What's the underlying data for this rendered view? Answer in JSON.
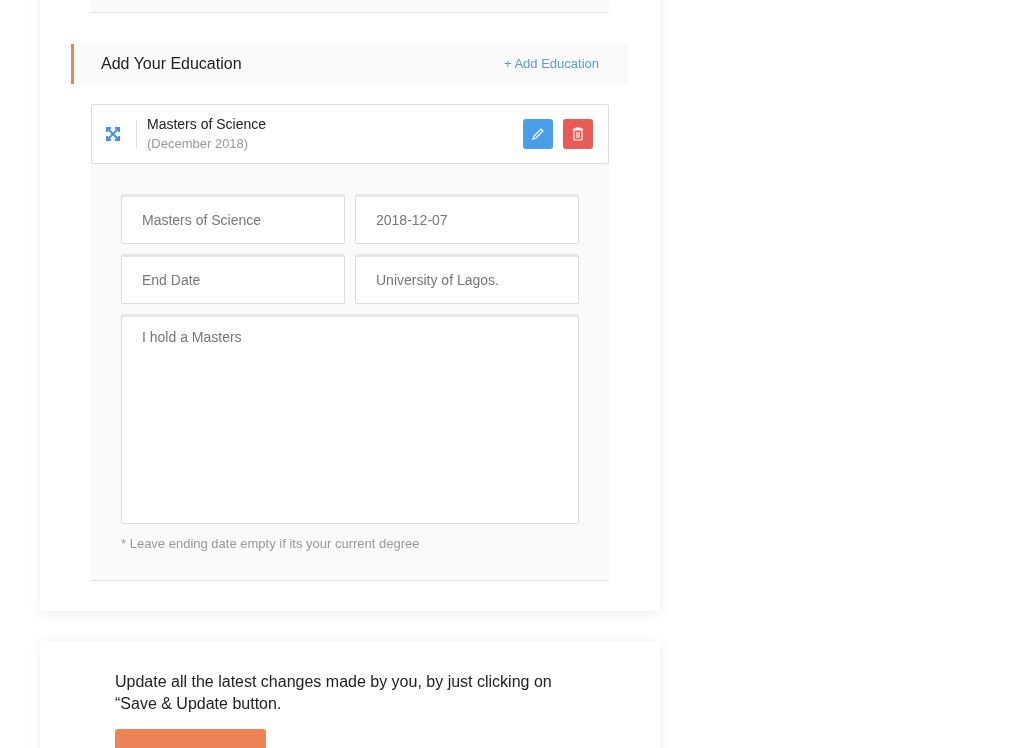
{
  "section": {
    "title": "Add Your Education",
    "add_link": "+ Add Education"
  },
  "education_items": [
    {
      "title": "Masters of Science",
      "date": "(December 2018)",
      "expanded": true,
      "fields": [
        {
          "kind": "input",
          "value": "Masters of Science"
        },
        {
          "kind": "input",
          "value": "2018-12-07"
        },
        {
          "kind": "input",
          "placeholder": "End Date"
        },
        {
          "kind": "input",
          "value": "University of Lagos."
        },
        {
          "kind": "textarea",
          "value": "I hold a Masters"
        }
      ],
      "note": "* Leave ending date empty if its your current degree"
    }
  ],
  "update_card": {
    "text": "Update all the latest changes made by you, by just clicking on “Save & Update button."
  }
}
